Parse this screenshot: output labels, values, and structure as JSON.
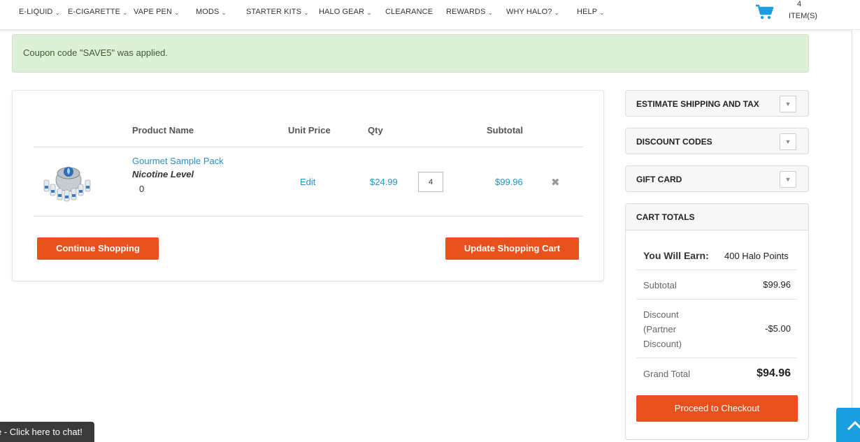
{
  "nav": {
    "items": [
      {
        "label": "E-LIQUID"
      },
      {
        "label": "E-CIGARETTE"
      },
      {
        "label": "VAPE PEN"
      },
      {
        "label": "MODS"
      },
      {
        "label": "STARTER KITS"
      },
      {
        "label": "HALO GEAR"
      },
      {
        "label": "CLEARANCE"
      },
      {
        "label": "REWARDS"
      },
      {
        "label": "WHY HALO?"
      },
      {
        "label": "HELP"
      }
    ],
    "cart_count": "4",
    "cart_items_label": "ITEM(S)",
    "cart_icon": "shopping-cart-icon"
  },
  "alert": {
    "message": "Coupon code \"SAVE5\" was applied."
  },
  "cart": {
    "headers": {
      "product_name": "Product Name",
      "unit_price": "Unit Price",
      "qty": "Qty",
      "subtotal": "Subtotal"
    },
    "items": [
      {
        "name": "Gourmet Sample Pack",
        "option_label": "Nicotine Level",
        "option_value": "0",
        "edit_label": "Edit",
        "unit_price": "$24.99",
        "qty": "4",
        "subtotal": "$99.96",
        "remove_icon": "close-icon"
      }
    ],
    "continue_label": "Continue Shopping",
    "update_label": "Update Shopping Cart"
  },
  "sidebar": {
    "estimate_label": "ESTIMATE SHIPPING AND TAX",
    "discount_label": "DISCOUNT CODES",
    "gift_label": "GIFT CARD",
    "totals": {
      "title": "CART TOTALS",
      "earn_label": "You Will Earn:",
      "earn_value": "400 Halo Points",
      "subtotal_label": "Subtotal",
      "subtotal_value": "$99.96",
      "discount_label_1": "Discount",
      "discount_label_2": "(Partner",
      "discount_label_3": "Discount)",
      "discount_value": "-$5.00",
      "grand_label": "Grand Total",
      "grand_value": "$94.96",
      "checkout_label": "Proceed to Checkout"
    }
  },
  "chat": {
    "label": "e - Click here to chat!"
  },
  "colors": {
    "accent": "#e8511e",
    "link": "#2b8fc6",
    "alert_bg": "#dff0d8",
    "top_button": "#1a9ee0"
  }
}
